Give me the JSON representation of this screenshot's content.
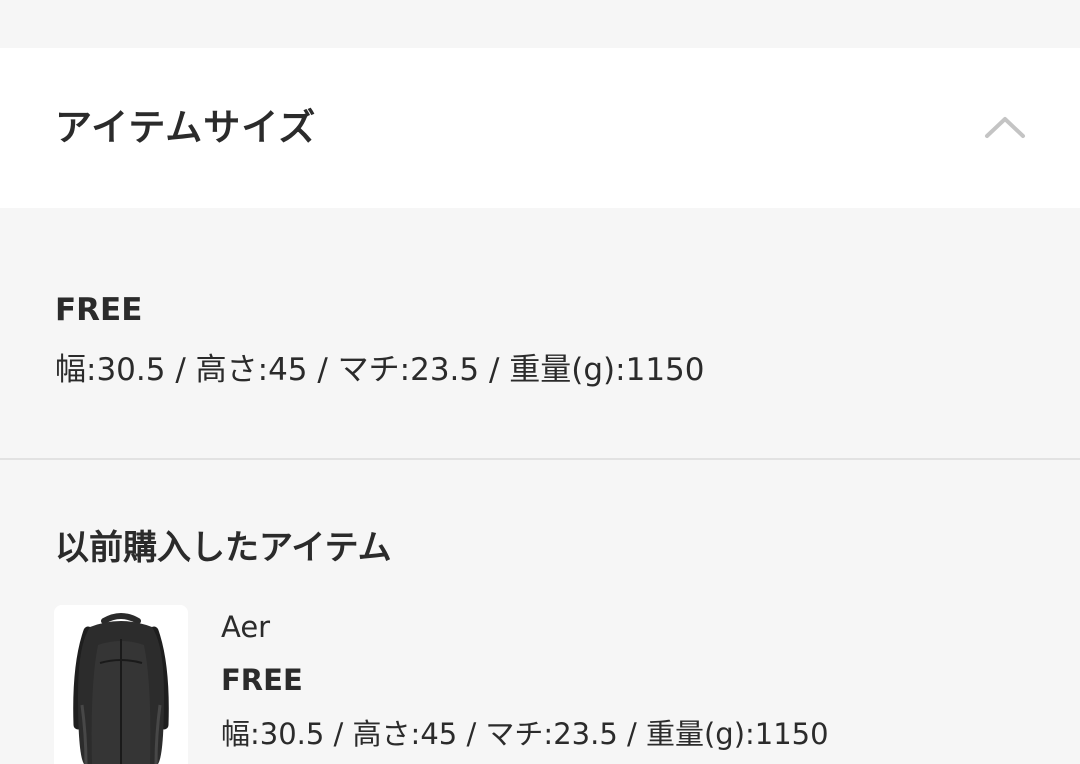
{
  "section": {
    "title": "アイテムサイズ",
    "toggle_icon": "chevron-up-icon"
  },
  "size": {
    "name": "FREE",
    "detail": "幅:30.5 / 高さ:45 / マチ:23.5 / 重量(g):1150"
  },
  "previous": {
    "title": "以前購入したアイテム",
    "item": {
      "image": "black-backpack-photo",
      "brand": "Aer",
      "size": "FREE",
      "detail": "幅:30.5 / 高さ:45 / マチ:23.5 / 重量(g):1150"
    }
  },
  "colors": {
    "text": "#2b2b2b",
    "background": "#f6f6f6",
    "header_background": "#ffffff",
    "chevron": "#c4c4c4",
    "divider": "#e2e2e2"
  }
}
